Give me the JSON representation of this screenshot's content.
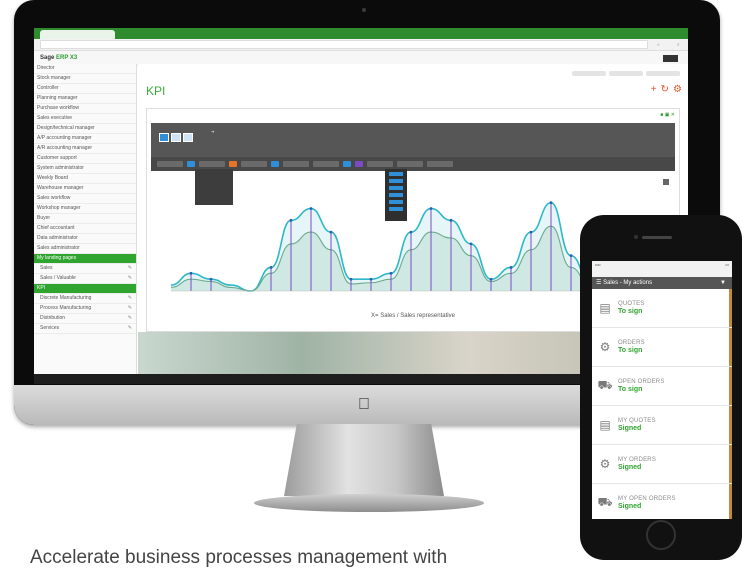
{
  "browser": {
    "tab_title": "",
    "url": ""
  },
  "app": {
    "brand_prefix": "Sage",
    "brand_suffix": "ERP X3",
    "page_heading": "KPI",
    "card_title": "",
    "x_axis_label": "X= Sales / Sales representative"
  },
  "sidebar": {
    "items": [
      {
        "label": "Director",
        "style": "normal"
      },
      {
        "label": "Stock manager",
        "style": "normal"
      },
      {
        "label": "Controller",
        "style": "normal"
      },
      {
        "label": "Planning manager",
        "style": "normal"
      },
      {
        "label": "Purchase workflow",
        "style": "normal"
      },
      {
        "label": "Sales executive",
        "style": "normal"
      },
      {
        "label": "Design/technical manager",
        "style": "normal"
      },
      {
        "label": "A/P accounting manager",
        "style": "normal"
      },
      {
        "label": "A/R accounting manager",
        "style": "normal"
      },
      {
        "label": "Customer support",
        "style": "normal"
      },
      {
        "label": "System administrator",
        "style": "normal"
      },
      {
        "label": "Weekly Board",
        "style": "normal"
      },
      {
        "label": "Warehouse manager",
        "style": "normal"
      },
      {
        "label": "Sales workflow",
        "style": "normal"
      },
      {
        "label": "Workshop manager",
        "style": "normal"
      },
      {
        "label": "Buyer",
        "style": "normal"
      },
      {
        "label": "Chief accountant",
        "style": "normal"
      },
      {
        "label": "Data administrator",
        "style": "normal"
      },
      {
        "label": "Sales administrator",
        "style": "normal"
      },
      {
        "label": "My landing pages",
        "style": "green"
      },
      {
        "label": "Sales",
        "style": "sub"
      },
      {
        "label": "Sales / Valuable",
        "style": "sub"
      },
      {
        "label": "KPI",
        "style": "green"
      },
      {
        "label": "Discrete Manufacturing",
        "style": "sub"
      },
      {
        "label": "Process Manufacturing",
        "style": "sub"
      },
      {
        "label": "Distribution",
        "style": "sub"
      },
      {
        "label": "Services",
        "style": "sub"
      }
    ]
  },
  "phone": {
    "header_title": "Sales - My actions",
    "rows": [
      {
        "title": "QUOTES",
        "status": "To sign",
        "icon": "document-icon"
      },
      {
        "title": "ORDERS",
        "status": "To sign",
        "icon": "gears-icon"
      },
      {
        "title": "OPEN ORDERS",
        "status": "To sign",
        "icon": "truck-icon"
      },
      {
        "title": "MY QUOTES",
        "status": "Signed",
        "icon": "document-icon"
      },
      {
        "title": "MY ORDERS",
        "status": "Signed",
        "icon": "gears-icon"
      },
      {
        "title": "MY OPEN ORDERS",
        "status": "Signed",
        "icon": "truck-icon"
      }
    ]
  },
  "caption": "Accelerate business processes management with",
  "colors": {
    "brand_green": "#2fa52f",
    "accent_orange": "#e8542a",
    "series_cyan": "#2fb8c8",
    "series_purple": "#7a4bc4"
  },
  "chart_data": {
    "type": "area",
    "title": "",
    "xlabel": "X= Sales / Sales representative",
    "ylabel": "",
    "categories": [],
    "series": [
      {
        "values": [
          0.5,
          1.5,
          1,
          0.5,
          0,
          2,
          6,
          7,
          5,
          1,
          1,
          1.5,
          5,
          7,
          6,
          4,
          1,
          2,
          5,
          7.5,
          3,
          0.5
        ]
      },
      {
        "values": [
          0.3,
          1,
          0.8,
          0.3,
          0,
          1.5,
          4,
          5,
          3.5,
          0.6,
          0.7,
          1,
          3.5,
          5,
          4.5,
          3,
          0.8,
          1.5,
          3.5,
          5.5,
          2,
          0.3
        ]
      }
    ],
    "ylim": [
      0,
      9
    ],
    "grid": false
  }
}
